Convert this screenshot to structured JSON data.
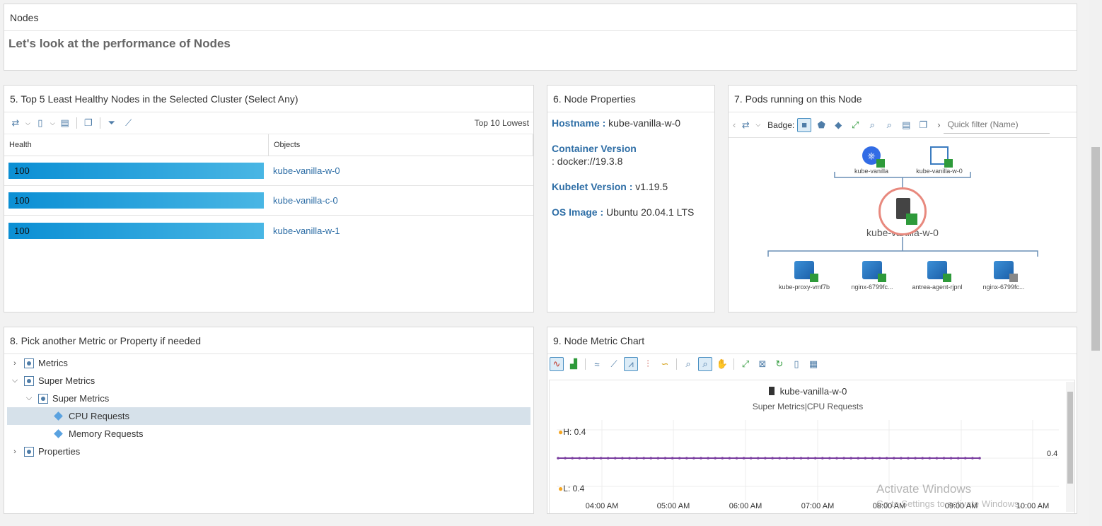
{
  "nodes_panel": {
    "title": "Nodes",
    "subtitle": "Let's look at the performance of Nodes"
  },
  "healthy_panel": {
    "title": "5. Top 5 Least Healthy Nodes in the Selected Cluster (Select Any)",
    "filter_label": "Top 10 Lowest",
    "columns": [
      "Health",
      "Objects"
    ],
    "rows": [
      {
        "health": "100",
        "object": "kube-vanilla-w-0"
      },
      {
        "health": "100",
        "object": "kube-vanilla-c-0"
      },
      {
        "health": "100",
        "object": "kube-vanilla-w-1"
      }
    ]
  },
  "props_panel": {
    "title": "6. Node Properties",
    "hostname_label": "Hostname :",
    "hostname_value": "kube-vanilla-w-0",
    "container_label": "Container Version",
    "container_value": ": docker://19.3.8",
    "kubelet_label": "Kubelet Version :",
    "kubelet_value": "v1.19.5",
    "os_label": "OS Image :",
    "os_value": "Ubuntu 20.04.1 LTS"
  },
  "pods_panel": {
    "title": "7. Pods running on this Node",
    "badge_label": "Badge:",
    "filter_placeholder": "Quick filter (Name)",
    "parents": [
      "kube-vanilla",
      "kube-vanilla-w-0"
    ],
    "center": "kube-vanilla-w-0",
    "children": [
      "kube-proxy-vmf7b",
      "nginx-6799fc...",
      "antrea-agent-rjpnl",
      "nginx-6799fc..."
    ],
    "colors": {
      "ok": "#2e9a3a",
      "unknown": "#888888",
      "halo": "#e8897e"
    }
  },
  "metric_panel": {
    "title": "8. Pick another Metric or Property if needed",
    "tree": {
      "metrics": "Metrics",
      "super_metrics": "Super Metrics",
      "super_metrics_child": "Super Metrics",
      "cpu": "CPU Requests",
      "memory": "Memory Requests",
      "properties": "Properties"
    }
  },
  "chart_panel": {
    "title": "9. Node Metric Chart",
    "object": "kube-vanilla-w-0",
    "metric": "Super Metrics|CPU Requests",
    "high_label": "H: 0.4",
    "low_label": "L: 0.4",
    "value_label": "0.4",
    "watermark_1": "Activate Windows",
    "watermark_2": "Go to Settings to activate Windows.",
    "line_color": "#7b3fa0"
  },
  "chart_data": {
    "type": "line",
    "title": "kube-vanilla-w-0",
    "subtitle": "Super Metrics|CPU Requests",
    "x_ticks": [
      "04:00 AM",
      "05:00 AM",
      "06:00 AM",
      "07:00 AM",
      "08:00 AM",
      "09:00 AM",
      "10:00 AM"
    ],
    "series": [
      {
        "values": [
          0.4,
          0.4,
          0.4,
          0.4,
          0.4,
          0.4,
          0.4,
          0.4,
          0.4,
          0.4,
          0.4,
          0.4,
          0.4,
          0.4,
          0.4,
          0.4,
          0.4,
          0.4,
          0.4,
          0.4,
          0.4,
          0.4,
          0.4,
          0.4,
          0.4,
          0.4,
          0.4,
          0.4,
          0.4,
          0.4,
          0.4,
          0.4,
          0.4,
          0.4,
          0.4,
          0.4,
          0.4,
          0.4,
          0.4,
          0.4,
          0.4,
          0.4,
          0.4,
          0.4,
          0.4,
          0.4,
          0.4,
          0.4,
          0.4,
          0.4,
          0.4,
          0.4,
          0.4,
          0.4,
          0.4,
          0.4,
          0.4,
          0.4,
          0.4,
          0.4
        ]
      }
    ],
    "high": 0.4,
    "low": 0.4,
    "grid": true
  }
}
